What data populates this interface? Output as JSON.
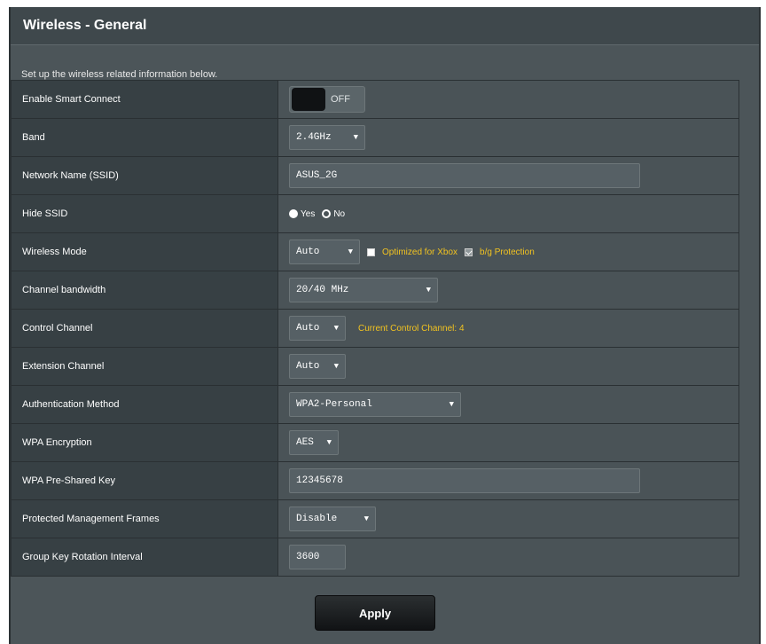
{
  "title": "Wireless - General",
  "subtitle": "Set up the wireless related information below.",
  "rows": {
    "smart_connect": {
      "label": "Enable Smart Connect",
      "toggle_state": "OFF"
    },
    "band": {
      "label": "Band",
      "value": "2.4GHz"
    },
    "ssid": {
      "label": "Network Name (SSID)",
      "value": "ASUS_2G"
    },
    "hide_ssid": {
      "label": "Hide SSID",
      "option_yes": "Yes",
      "option_no": "No",
      "selected": "Yes"
    },
    "wireless_mode": {
      "label": "Wireless Mode",
      "value": "Auto",
      "xbox_label": "Optimized for Xbox",
      "bg_label": "b/g Protection",
      "xbox_checked": false,
      "bg_checked": true
    },
    "channel_bandwidth": {
      "label": "Channel bandwidth",
      "value": "20/40 MHz"
    },
    "control_channel": {
      "label": "Control Channel",
      "value": "Auto",
      "current": "Current Control Channel: 4"
    },
    "extension_channel": {
      "label": "Extension Channel",
      "value": "Auto"
    },
    "auth_method": {
      "label": "Authentication Method",
      "value": "WPA2-Personal"
    },
    "wpa_encryption": {
      "label": "WPA Encryption",
      "value": "AES"
    },
    "wpa_key": {
      "label": "WPA Pre-Shared Key",
      "value": "12345678"
    },
    "pmf": {
      "label": "Protected Management Frames",
      "value": "Disable"
    },
    "group_key": {
      "label": "Group Key Rotation Interval",
      "value": "3600"
    }
  },
  "apply_label": "Apply",
  "colors": {
    "accent_text": "#f2c320",
    "panel_bg": "#4c5559",
    "label_bg": "#374044"
  },
  "icons": {
    "dropdown": "caret-down-icon"
  }
}
